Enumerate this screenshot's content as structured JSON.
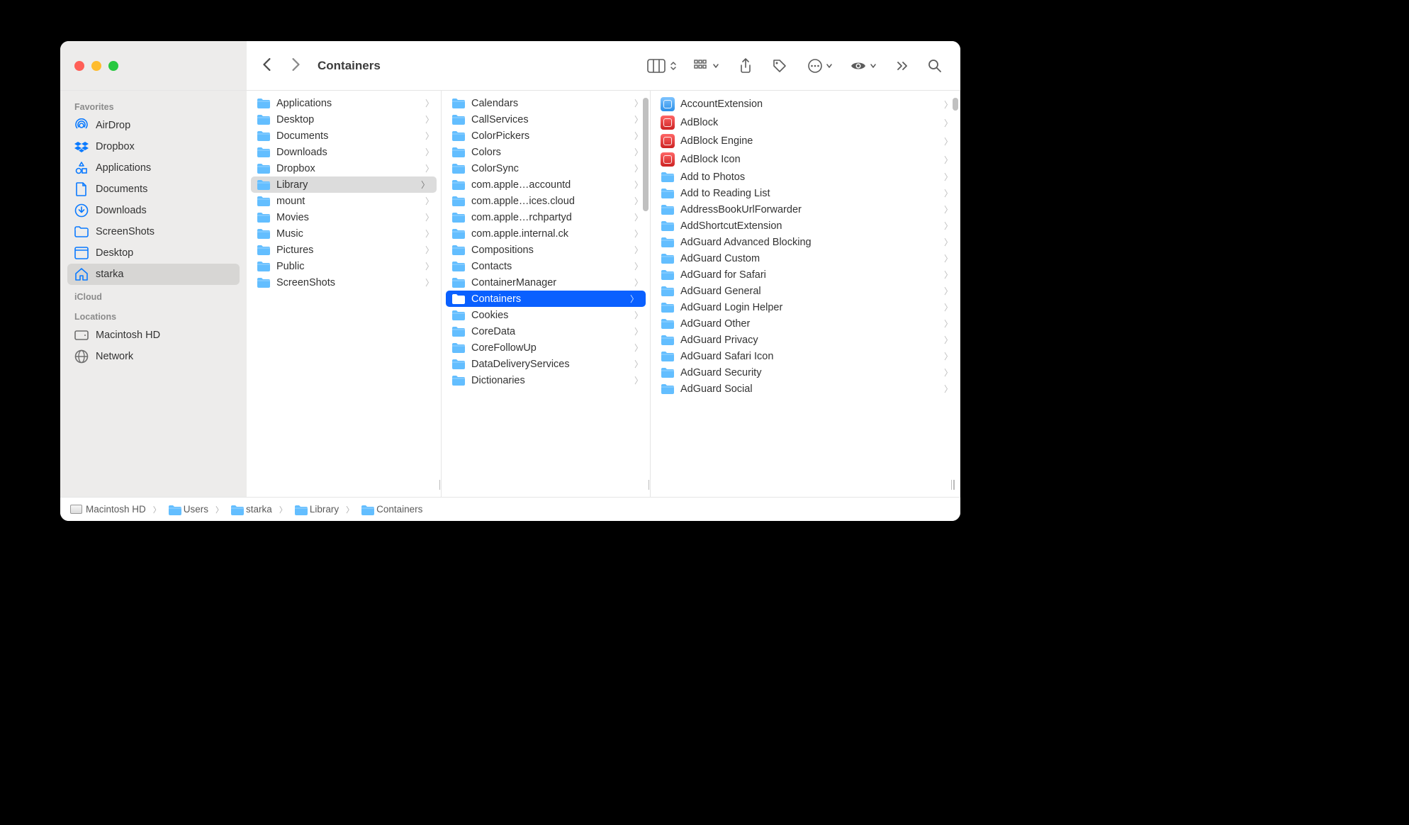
{
  "window": {
    "title": "Containers"
  },
  "sidebar": {
    "sections": [
      {
        "header": "Favorites",
        "items": [
          {
            "label": "AirDrop",
            "icon": "airdrop"
          },
          {
            "label": "Dropbox",
            "icon": "dropbox"
          },
          {
            "label": "Applications",
            "icon": "apps"
          },
          {
            "label": "Documents",
            "icon": "doc"
          },
          {
            "label": "Downloads",
            "icon": "download"
          },
          {
            "label": "ScreenShots",
            "icon": "folder"
          },
          {
            "label": "Desktop",
            "icon": "desktop"
          },
          {
            "label": "starka",
            "icon": "home",
            "selected": true
          }
        ]
      },
      {
        "header": "iCloud",
        "items": []
      },
      {
        "header": "Locations",
        "items": [
          {
            "label": "Macintosh HD",
            "icon": "hdd",
            "gray": true
          },
          {
            "label": "Network",
            "icon": "globe",
            "gray": true
          }
        ]
      }
    ]
  },
  "columns": [
    {
      "items": [
        {
          "label": "Applications"
        },
        {
          "label": "Desktop"
        },
        {
          "label": "Documents"
        },
        {
          "label": "Downloads"
        },
        {
          "label": "Dropbox"
        },
        {
          "label": "Library",
          "selected": "gray"
        },
        {
          "label": "mount"
        },
        {
          "label": "Movies"
        },
        {
          "label": "Music"
        },
        {
          "label": "Pictures"
        },
        {
          "label": "Public"
        },
        {
          "label": "ScreenShots"
        }
      ]
    },
    {
      "items": [
        {
          "label": "Calendars"
        },
        {
          "label": "CallServices"
        },
        {
          "label": "ColorPickers"
        },
        {
          "label": "Colors"
        },
        {
          "label": "ColorSync"
        },
        {
          "label": "com.apple…accountd"
        },
        {
          "label": "com.apple…ices.cloud"
        },
        {
          "label": "com.apple…rchpartyd"
        },
        {
          "label": "com.apple.internal.ck"
        },
        {
          "label": "Compositions"
        },
        {
          "label": "Contacts"
        },
        {
          "label": "ContainerManager"
        },
        {
          "label": "Containers",
          "selected": "blue"
        },
        {
          "label": "Cookies"
        },
        {
          "label": "CoreData"
        },
        {
          "label": "CoreFollowUp"
        },
        {
          "label": "DataDeliveryServices"
        },
        {
          "label": "Dictionaries"
        }
      ]
    },
    {
      "items": [
        {
          "label": "AccountExtension",
          "icon": "app-blue"
        },
        {
          "label": "AdBlock",
          "icon": "app"
        },
        {
          "label": "AdBlock Engine",
          "icon": "app"
        },
        {
          "label": "AdBlock Icon",
          "icon": "app"
        },
        {
          "label": "Add to Photos"
        },
        {
          "label": "Add to Reading List"
        },
        {
          "label": "AddressBookUrlForwarder"
        },
        {
          "label": "AddShortcutExtension"
        },
        {
          "label": "AdGuard Advanced Blocking"
        },
        {
          "label": "AdGuard Custom"
        },
        {
          "label": "AdGuard for Safari"
        },
        {
          "label": "AdGuard General"
        },
        {
          "label": "AdGuard Login Helper"
        },
        {
          "label": "AdGuard Other"
        },
        {
          "label": "AdGuard Privacy"
        },
        {
          "label": "AdGuard Safari Icon"
        },
        {
          "label": "AdGuard Security"
        },
        {
          "label": "AdGuard Social"
        }
      ]
    }
  ],
  "pathbar": [
    {
      "label": "Macintosh HD",
      "icon": "hdd"
    },
    {
      "label": "Users",
      "icon": "folder"
    },
    {
      "label": "starka",
      "icon": "folder"
    },
    {
      "label": "Library",
      "icon": "folder"
    },
    {
      "label": "Containers",
      "icon": "folder"
    }
  ]
}
